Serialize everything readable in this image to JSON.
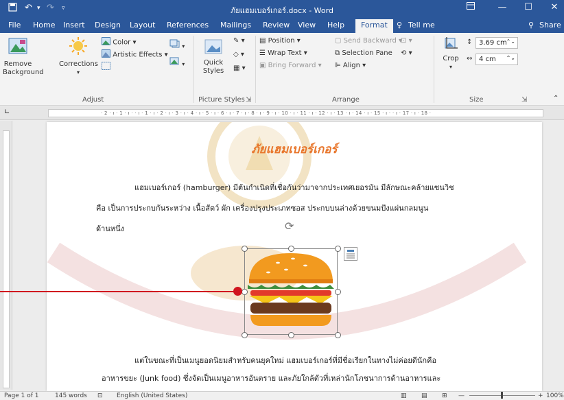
{
  "titlebar": {
    "doc_title": "ภัยแฮมเบอร์เกอร์.docx  -  Word",
    "icons": [
      "save-icon",
      "undo-icon",
      "redo-icon",
      "customize-icon",
      "ribbon-display-icon",
      "minimize-icon",
      "maximize-icon",
      "close-icon"
    ]
  },
  "tabs": [
    {
      "label": "File"
    },
    {
      "label": "Home"
    },
    {
      "label": "Insert"
    },
    {
      "label": "Design"
    },
    {
      "label": "Layout"
    },
    {
      "label": "References"
    },
    {
      "label": "Mailings"
    },
    {
      "label": "Review"
    },
    {
      "label": "View"
    },
    {
      "label": "Help"
    },
    {
      "label": "Format"
    }
  ],
  "tell_me": "Tell me",
  "share": "Share",
  "ribbon": {
    "remove_background": "Remove Background",
    "corrections": "Corrections",
    "color": "Color",
    "artistic_effects": "Artistic Effects",
    "quick_styles": "Quick Styles",
    "position": "Position",
    "wrap_text": "Wrap Text",
    "bring_forward": "Bring Forward",
    "send_backward": "Send Backward",
    "selection_pane": "Selection Pane",
    "align": "Align",
    "crop": "Crop",
    "height": "3.69 cm",
    "width": "4 cm",
    "groups": {
      "adjust": "Adjust",
      "picture_styles": "Picture Styles",
      "arrange": "Arrange",
      "size": "Size"
    }
  },
  "ruler_text": "· 2 · ı · 1 · ı ·    · ı · 1 · ı · 2 · ı · 3 · ı · 4 · ı · 5 · ı · 6 · ı · 7 · ı · 8 · ı · 9 · ı · 10 · ı · 11 · ı · 12 · ı · 13 · ı · 14 · ı · 15 · ı ·    · ı · 17 · ı · 18 ·",
  "document": {
    "title": "ภัยแฮมเบอร์เกอร์",
    "para1_line1": "แฮมเบอร์เกอร์ (hamburger) มีต้นกำเนิดที่เชื่อกันว่ามาจากประเทศเยอรมัน มีลักษณะคล้ายแซนวิช",
    "para1_line2": "คือ เป็นการประกบกันระหว่าง เนื้อสัตว์ ผัก เครื่องปรุงประเภทซอส ประกบบนล่างด้วยขนมปังแผ่นกลมนูน",
    "para1_line3": "ด้านหนึ่ง",
    "para2_line1": "แต่ในขณะที่เป็นเมนูยอดนิยมสำหรับคนยุคใหม่  แฮมเบอร์เกอร์ที่มีชื่อเรียกในทางไม่ค่อยดีนักคือ",
    "para2_line2": "อาหารขยะ (Junk food) ซึ่งจัดเป็นเมนูอาหารอันตราย และภัยใกล้ตัวที่เหล่านักโภชนาการด้านอาหารและ"
  },
  "status": {
    "page": "Page 1 of 1",
    "words": "145 words",
    "language": "English (United States)",
    "zoom": "100%"
  },
  "colors": {
    "accent": "#2b579a",
    "annotation": "#d0161f",
    "title_text": "#e8762c"
  }
}
